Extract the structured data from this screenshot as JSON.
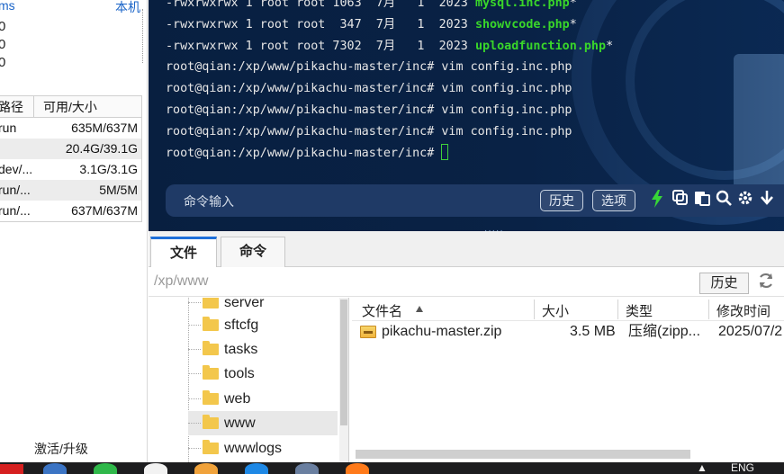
{
  "left_panel": {
    "top_left_label": "ms",
    "top_right_label": "本机",
    "numbers": [
      "0",
      "0",
      "0"
    ],
    "disk_table": {
      "headers": [
        "路径",
        "可用/大小"
      ],
      "rows": [
        {
          "path": "run",
          "size": "635M/637M"
        },
        {
          "path": "",
          "size_free": "20.4G/",
          "size_total": "39.1G"
        },
        {
          "path": "dev/...",
          "size": "3.1G/3.1G"
        },
        {
          "path": "run/...",
          "size": "5M/5M"
        },
        {
          "path": "run/...",
          "size": "637M/637M"
        }
      ]
    },
    "activate_label": "激活/升级"
  },
  "terminal": {
    "lines": [
      {
        "prefix": "-rwxrwxrwx 1 root root 1063  7月   1  2023 ",
        "file": "mysql.inc.php",
        "suffix": "*"
      },
      {
        "prefix": "-rwxrwxrwx 1 root root  347  7月   1  2023 ",
        "file": "showvcode.php",
        "suffix": "*"
      },
      {
        "prefix": "-rwxrwxrwx 1 root root 7302  7月   1  2023 ",
        "file": "uploadfunction.php",
        "suffix": "*"
      }
    ],
    "commands": [
      "root@qian:/xp/www/pikachu-master/inc# vim config.inc.php",
      "root@qian:/xp/www/pikachu-master/inc# vim config.inc.php",
      "root@qian:/xp/www/pikachu-master/inc# vim config.inc.php",
      "root@qian:/xp/www/pikachu-master/inc# vim config.inc.php"
    ],
    "prompt": "root@qian:/xp/www/pikachu-master/inc# ",
    "command_input_placeholder": "命令输入",
    "history_button": "历史",
    "options_button": "选项",
    "icons": [
      "lightning-icon",
      "copy-icon",
      "paste-icon",
      "search-icon",
      "gear-icon",
      "download-icon"
    ]
  },
  "tabs": [
    {
      "label": "文件",
      "active": true
    },
    {
      "label": "命令",
      "active": false
    }
  ],
  "path_bar": {
    "path": "/xp/www",
    "history_button": "历史"
  },
  "tree": {
    "items": [
      {
        "name": "server"
      },
      {
        "name": "sftcfg"
      },
      {
        "name": "tasks"
      },
      {
        "name": "tools"
      },
      {
        "name": "web"
      },
      {
        "name": "www",
        "selected": true
      },
      {
        "name": "wwwlogs"
      }
    ]
  },
  "file_list": {
    "headers": {
      "name": "文件名",
      "size": "大小",
      "type": "类型",
      "modified": "修改时间"
    },
    "rows": [
      {
        "name": "pikachu-master.zip",
        "size": "3.5 MB",
        "type": "压缩(zipp...",
        "modified": "2025/07/2"
      }
    ]
  },
  "taskbar": {
    "language": "ENG"
  },
  "colors": {
    "terminal_bg": "#0b2a55",
    "prompt_green": "#39d62a",
    "tab_accent": "#1e6fd9"
  }
}
